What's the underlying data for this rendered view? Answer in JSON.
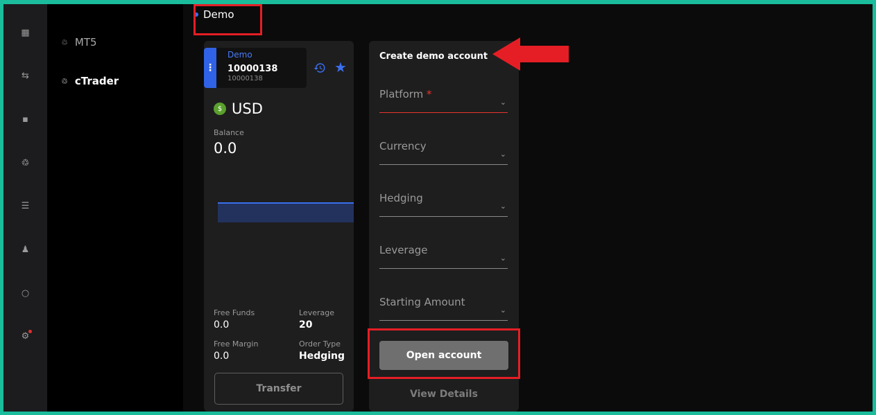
{
  "sidebar_icons": [
    {
      "name": "grid-icon",
      "glyph": "▦",
      "badge": false
    },
    {
      "name": "transfer-icon",
      "glyph": "⇆",
      "badge": false
    },
    {
      "name": "wallet-icon",
      "glyph": "▪",
      "badge": false
    },
    {
      "name": "platforms-icon",
      "glyph": "♲",
      "badge": false
    },
    {
      "name": "list-icon",
      "glyph": "☰",
      "badge": false
    },
    {
      "name": "user-icon",
      "glyph": "♟",
      "badge": false
    },
    {
      "name": "chat-icon",
      "glyph": "○",
      "badge": false
    },
    {
      "name": "settings-icon",
      "glyph": "⚙",
      "badge": true
    }
  ],
  "nav": {
    "mt5": "MT5",
    "ctrader": "cTrader"
  },
  "tab": {
    "label": "Demo"
  },
  "account": {
    "type_label": "Demo",
    "number": "10000138",
    "sub_number": "10000138",
    "currency": "USD",
    "currency_symbol": "$",
    "balance_label": "Balance",
    "balance_value": "0.0",
    "free_funds_label": "Free Funds",
    "free_funds_value": "0.0",
    "leverage_label": "Leverage",
    "leverage_value": "20",
    "free_margin_label": "Free Margin",
    "free_margin_value": "0.0",
    "order_type_label": "Order Type",
    "order_type_value": "Hedging",
    "transfer_label": "Transfer"
  },
  "create": {
    "title": "Create demo account",
    "fields": [
      {
        "label": "Platform",
        "required": true
      },
      {
        "label": "Currency",
        "required": false
      },
      {
        "label": "Hedging",
        "required": false
      },
      {
        "label": "Leverage",
        "required": false
      },
      {
        "label": "Starting Amount",
        "required": false
      }
    ],
    "required_mark": "*",
    "open_label": "Open account",
    "details_label": "View Details"
  },
  "colors": {
    "accent": "#3b6ff0",
    "annotation": "#e51e25",
    "frame": "#1abc9c"
  }
}
